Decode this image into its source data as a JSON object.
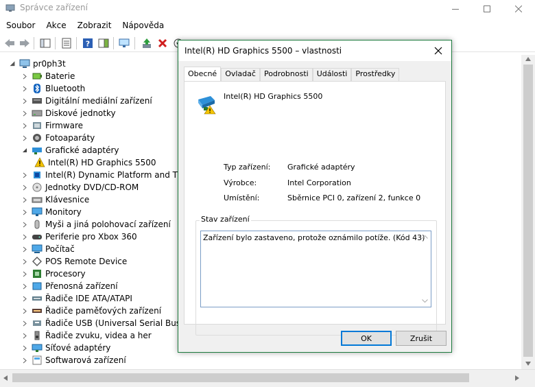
{
  "window": {
    "title": "Správce zařízení"
  },
  "menu": [
    "Soubor",
    "Akce",
    "Zobrazit",
    "Nápověda"
  ],
  "tree": {
    "root": "pr0ph3t",
    "items": [
      {
        "label": "Baterie",
        "icon": "battery-icon",
        "expanded": false
      },
      {
        "label": "Bluetooth",
        "icon": "bluetooth-icon",
        "expanded": false
      },
      {
        "label": "Digitální mediální zařízení",
        "icon": "media-device-icon",
        "expanded": false
      },
      {
        "label": "Diskové jednotky",
        "icon": "disk-drive-icon",
        "expanded": false
      },
      {
        "label": "Firmware",
        "icon": "firmware-icon",
        "expanded": false
      },
      {
        "label": "Fotoaparáty",
        "icon": "camera-icon",
        "expanded": false
      },
      {
        "label": "Grafické adaptéry",
        "icon": "display-adapter-icon",
        "expanded": true
      },
      {
        "label": "Intel(R) HD Graphics 5500",
        "icon": "warning-icon",
        "child": true
      },
      {
        "label": "Intel(R) Dynamic Platform and Thermal Framework",
        "icon": "chip-icon",
        "expanded": false
      },
      {
        "label": "Jednotky DVD/CD-ROM",
        "icon": "dvd-icon",
        "expanded": false
      },
      {
        "label": "Klávesnice",
        "icon": "keyboard-icon",
        "expanded": false
      },
      {
        "label": "Monitory",
        "icon": "monitor-icon",
        "expanded": false
      },
      {
        "label": "Myši a jiná polohovací zařízení",
        "icon": "mouse-icon",
        "expanded": false
      },
      {
        "label": "Periferie pro Xbox 360",
        "icon": "gamepad-icon",
        "expanded": false
      },
      {
        "label": "Počítač",
        "icon": "computer-icon",
        "expanded": false
      },
      {
        "label": "POS Remote Device",
        "icon": "pos-icon",
        "expanded": false
      },
      {
        "label": "Procesory",
        "icon": "processor-icon",
        "expanded": false
      },
      {
        "label": "Přenosná zařízení",
        "icon": "portable-device-icon",
        "expanded": false
      },
      {
        "label": "Řadiče IDE ATA/ATAPI",
        "icon": "ide-controller-icon",
        "expanded": false
      },
      {
        "label": "Řadiče paměťových zařízení",
        "icon": "storage-controller-icon",
        "expanded": false
      },
      {
        "label": "Řadiče USB (Universal Serial Bus)",
        "icon": "usb-icon",
        "expanded": false
      },
      {
        "label": "Řadiče zvuku, videa a her",
        "icon": "sound-icon",
        "expanded": false
      },
      {
        "label": "Síťové adaptéry",
        "icon": "network-icon",
        "expanded": false
      },
      {
        "label": "Softwarová zařízení",
        "icon": "software-device-icon",
        "expanded": false
      }
    ]
  },
  "dialog": {
    "title": "Intel(R) HD Graphics 5500 – vlastnosti",
    "tabs": [
      "Obecné",
      "Ovladač",
      "Podrobnosti",
      "Události",
      "Prostředky"
    ],
    "device_name": "Intel(R) HD Graphics 5500",
    "properties": [
      {
        "label": "Typ zařízení:",
        "value": "Grafické adaptéry"
      },
      {
        "label": "Výrobce:",
        "value": "Intel Corporation"
      },
      {
        "label": "Umístění:",
        "value": "Sběrnice PCI 0, zařízení 2, funkce 0"
      }
    ],
    "status_label": "Stav zařízení",
    "status_text": "Zařízení bylo zastaveno, protože oznámilo potíže. (Kód 43)",
    "ok_label": "OK",
    "cancel_label": "Zrušit"
  },
  "colors": {
    "accent": "#0078d7",
    "dialog_border": "#1a7a3c",
    "warning": "#f5c400"
  }
}
